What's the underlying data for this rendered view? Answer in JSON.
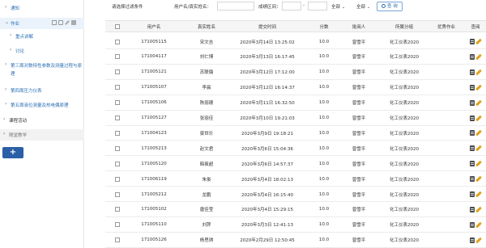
{
  "sidebar": {
    "items": [
      {
        "label": "通知",
        "chev": "›"
      },
      {
        "label": "作业",
        "chev": "⌄"
      },
      {
        "label": "重点讲解",
        "chev": "›"
      },
      {
        "label": "讨论",
        "chev": "›"
      },
      {
        "label": "第三周对数特性参数及测量过程与原理",
        "chev": "›"
      },
      {
        "label": "第四周压力仪表",
        "chev": "›"
      },
      {
        "label": "第五周液位测量及热电偶原理",
        "chev": "›"
      },
      {
        "label": "课程活动",
        "chev": "›"
      },
      {
        "label": "随堂教学",
        "chev": "›"
      }
    ],
    "add_label": "+"
  },
  "filters": {
    "status_label": "请选择过滤条件",
    "user_label": "用户名/真实姓名：",
    "score_label": "成绩区间：",
    "dash": "-",
    "select1": "全部",
    "select2": "全部",
    "search_label": "查 询"
  },
  "table": {
    "headers": [
      "用户名",
      "真实姓名",
      "提交时间",
      "分数",
      "批阅人",
      "所属分组",
      "优秀作业",
      "查阅"
    ],
    "rows": [
      {
        "user": "171005115",
        "name": "宋文吉",
        "time": "2020年3月14日 13:25:02",
        "score": "10.0",
        "reviewer": "曾雪平",
        "group": "化工仪表2020"
      },
      {
        "user": "171004117",
        "name": "刘仁博",
        "time": "2020年3月13日 16:17:45",
        "score": "10.0",
        "reviewer": "曾雪平",
        "group": "化工仪表2020"
      },
      {
        "user": "171005121",
        "name": "苏联璐",
        "time": "2020年3月12日 17:12:00",
        "score": "10.0",
        "reviewer": "曾雪平",
        "group": "化工仪表2020"
      },
      {
        "user": "171005107",
        "name": "李晨",
        "time": "2020年3月12日 16:14:37",
        "score": "10.0",
        "reviewer": "曾雪平",
        "group": "化工仪表2020"
      },
      {
        "user": "171005106",
        "name": "陈丽珊",
        "time": "2020年3月11日 16:32:50",
        "score": "10.0",
        "reviewer": "曾雪平",
        "group": "化工仪表2020"
      },
      {
        "user": "171005127",
        "name": "张丽佳",
        "time": "2020年3月10日 19:21:03",
        "score": "10.0",
        "reviewer": "曾雪平",
        "group": "化工仪表2020"
      },
      {
        "user": "171004123",
        "name": "梁世乐",
        "time": "2020年3月9日 19:18:21",
        "score": "10.0",
        "reviewer": "曾雪平",
        "group": "化工仪表2020"
      },
      {
        "user": "171005213",
        "name": "赵文君",
        "time": "2020年3月6日 15:04:36",
        "score": "10.0",
        "reviewer": "曾雪平",
        "group": "化工仪表2020"
      },
      {
        "user": "171005120",
        "name": "韩筱超",
        "time": "2020年3月6日 14:57:37",
        "score": "10.0",
        "reviewer": "曾雪平",
        "group": "化工仪表2020"
      },
      {
        "user": "171006119",
        "name": "朱俊",
        "time": "2020年3月4日 18:02:13",
        "score": "10.0",
        "reviewer": "曾雪平",
        "group": "化工仪表2020"
      },
      {
        "user": "171005212",
        "name": "龙鹏",
        "time": "2020年3月4日 16:15:40",
        "score": "10.0",
        "reviewer": "曾雪平",
        "group": "化工仪表2020"
      },
      {
        "user": "171005102",
        "name": "唐佳莹",
        "time": "2020年3月4日 15:29:15",
        "score": "10.0",
        "reviewer": "曾雪平",
        "group": "化工仪表2020"
      },
      {
        "user": "171005110",
        "name": "刘羿",
        "time": "2020年3月3日 12:41:13",
        "score": "10.0",
        "reviewer": "曾雪平",
        "group": "化工仪表2020"
      },
      {
        "user": "171005126",
        "name": "杨思琪",
        "time": "2020年2月29日 12:50:45",
        "score": "10.0",
        "reviewer": "曾雪平",
        "group": "化工仪表2020"
      }
    ]
  },
  "colors": {
    "accent": "#2b6fb4",
    "button": "#2a5fa7",
    "pen": "#e0a21a"
  }
}
